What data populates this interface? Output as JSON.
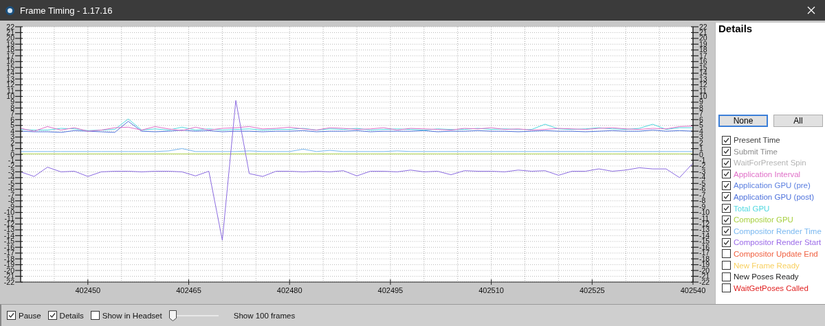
{
  "window": {
    "title": "Frame Timing - 1.17.16"
  },
  "chart": {
    "chart_data": {
      "type": "line",
      "x": [
        402440,
        402442,
        402444,
        402446,
        402448,
        402450,
        402452,
        402454,
        402456,
        402458,
        402460,
        402462,
        402464,
        402466,
        402468,
        402470,
        402472,
        402474,
        402476,
        402478,
        402480,
        402482,
        402484,
        402486,
        402488,
        402490,
        402492,
        402494,
        402496,
        402498,
        402500,
        402502,
        402504,
        402506,
        402508,
        402510,
        402512,
        402514,
        402516,
        402518,
        402520,
        402522,
        402524,
        402526,
        402528,
        402530,
        402532,
        402534,
        402536,
        402538,
        402540
      ],
      "series": [
        {
          "color": "#4f73dc",
          "values": [
            4,
            3.9,
            3.9,
            3.8,
            4.1,
            4.0,
            3.9,
            3.8,
            5.7,
            4.0,
            3.9,
            4.0,
            4.2,
            4.0,
            4.1,
            3.9,
            4.0,
            4.0,
            3.9,
            4.0,
            4.0,
            4.1,
            3.9,
            4.0,
            4.0,
            4.1,
            3.9,
            4.0,
            4.0,
            4.0,
            4.1,
            3.9,
            4.0,
            4.0,
            4.1,
            4.0,
            4.0,
            3.9,
            4.0,
            4.1,
            4.0,
            4.0,
            3.9,
            4.0,
            4.1,
            4.0,
            4.0,
            4.2,
            4.0,
            4.1,
            4.0
          ]
        },
        {
          "color": "#50d8e0",
          "values": [
            4.3,
            4.2,
            4.2,
            4.5,
            4.4,
            4.1,
            4.2,
            4.3,
            6.1,
            4.2,
            4.4,
            4.2,
            4.7,
            4.2,
            4.4,
            4.2,
            4.3,
            4.4,
            4.2,
            4.3,
            4.3,
            4.5,
            4.2,
            4.4,
            4.3,
            4.5,
            4.2,
            4.3,
            4.4,
            4.3,
            4.2,
            4.4,
            4.3,
            4.3,
            4.5,
            4.3,
            4.4,
            4.3,
            4.3,
            5.2,
            4.4,
            4.3,
            4.4,
            4.6,
            4.4,
            4.3,
            4.5,
            5.2,
            4.3,
            4.6,
            4.6
          ]
        },
        {
          "color": "#e070c8",
          "values": [
            4.5,
            4.0,
            4.8,
            4.2,
            4.6,
            4.0,
            4.2,
            4.6,
            4.7,
            4.2,
            4.8,
            4.4,
            4.1,
            4.7,
            4.2,
            4.5,
            4.6,
            4.8,
            4.4,
            4.5,
            4.7,
            4.4,
            4.2,
            4.6,
            4.5,
            4.3,
            4.4,
            4.6,
            4.2,
            4.5,
            4.4,
            4.3,
            4.2,
            4.5,
            4.4,
            4.6,
            4.3,
            4.4,
            4.2,
            4.3,
            4.5,
            4.4,
            4.3,
            4.5,
            4.6,
            4.4,
            4.3,
            4.5,
            4.4,
            4.8,
            4.9
          ]
        },
        {
          "color": "#7ab8f0",
          "values": [
            0.5,
            0.5,
            0.5,
            0.5,
            0.5,
            0.5,
            0.5,
            0.5,
            0.5,
            0.5,
            0.5,
            0.6,
            1.0,
            0.5,
            0.5,
            0.5,
            0.5,
            0.6,
            0.5,
            0.5,
            0.5,
            0.9,
            0.5,
            0.7,
            0.5,
            0.5,
            0.5,
            0.5,
            0.6,
            0.5,
            0.5,
            0.5,
            0.5,
            0.5,
            0.5,
            0.5,
            0.5,
            0.5,
            0.5,
            0.5,
            0.5,
            0.5,
            0.5,
            0.5,
            0.5,
            0.5,
            0.5,
            0.5,
            0.5,
            0.5,
            0.5
          ]
        },
        {
          "color": "#a8d040",
          "values": [
            0.1,
            0.1,
            0.1,
            0.1,
            0.1,
            0.1,
            0.1,
            0.1,
            0.1,
            0.1,
            0.1,
            0.1,
            0.1,
            0.1,
            0.1,
            0.1,
            0.1,
            0.1,
            0.1,
            0.1,
            0.1,
            0.1,
            0.1,
            0.1,
            0.1,
            0.1,
            0.1,
            0.1,
            0.1,
            0.1,
            0.1,
            0.1,
            0.1,
            0.1,
            0.1,
            0.1,
            0.1,
            0.1,
            0.1,
            0.1,
            0.1,
            0.1,
            0.1,
            0.1,
            0.1,
            0.1,
            0.1,
            0.1,
            0.1,
            0.1,
            0.1
          ]
        },
        {
          "color": "#8a6ae0",
          "values": [
            -3,
            -3.8,
            -2.2,
            -3,
            -2.9,
            -3.8,
            -3,
            -2.9,
            -2.9,
            -3,
            -2.9,
            -2.9,
            -3,
            -3.7,
            -2.9,
            -14.8,
            9.3,
            -3.3,
            -3.8,
            -2.9,
            -2.9,
            -3,
            -2.9,
            -3,
            -2.8,
            -3.7,
            -2.9,
            -2.9,
            -3,
            -2.7,
            -3,
            -2.9,
            -3.5,
            -2.8,
            -2.9,
            -2.9,
            -3,
            -2.7,
            -2.9,
            -2.8,
            -3.6,
            -2.9,
            -2.9,
            -2.5,
            -2.9,
            -2.7,
            -2.3,
            -2.5,
            -2.5,
            -4.0,
            -1.5
          ]
        }
      ],
      "xlim": [
        402440,
        402540
      ],
      "ylim": [
        -22,
        22
      ],
      "xticks": [
        402450,
        402465,
        402480,
        402495,
        402510,
        402525,
        402540
      ],
      "yticks": [
        22,
        21,
        20,
        19,
        18,
        17,
        16,
        15,
        14,
        13,
        12,
        11,
        10,
        9,
        8,
        7,
        6,
        5,
        4,
        3,
        2,
        1,
        0,
        -1,
        -2,
        -3,
        -4,
        -5,
        -6,
        -7,
        -8,
        -9,
        -10,
        -11,
        -12,
        -13,
        -14,
        -15,
        -16,
        -17,
        -18,
        -19,
        -20,
        -21,
        -22
      ],
      "grid": true
    },
    "right_axis_labels": [
      "22",
      "21",
      "20",
      "19",
      "18",
      "17",
      "16",
      "15",
      "14",
      "13",
      "12",
      "11",
      "10",
      "9",
      "8",
      "7",
      "6",
      "5",
      "4",
      "3",
      "2",
      "1",
      "0",
      "-1",
      "-2",
      "-3",
      "-4",
      "-5",
      "-6",
      "-7",
      "-8",
      "-9",
      "-10",
      "-11",
      "-12",
      "-13",
      "-14",
      "-15",
      "-16",
      "-17",
      "-18",
      "-19",
      "-20",
      "-21",
      "-22"
    ]
  },
  "details": {
    "title": "Details",
    "buttons": [
      {
        "label": "None",
        "selected": true
      },
      {
        "label": "All",
        "selected": false
      }
    ],
    "items": [
      {
        "label": "Present Time",
        "checked": true,
        "color": "#404040"
      },
      {
        "label": "Submit Time",
        "checked": true,
        "color": "#8c8c8c"
      },
      {
        "label": "WaitForPresent Spin",
        "checked": true,
        "color": "#b4b4b4"
      },
      {
        "label": "Application Interval",
        "checked": true,
        "color": "#e070c8"
      },
      {
        "label": "Application GPU (pre)",
        "checked": true,
        "color": "#5b7fe0"
      },
      {
        "label": "Application GPU (post)",
        "checked": true,
        "color": "#4f73dc"
      },
      {
        "label": "Total GPU",
        "checked": true,
        "color": "#50d8e0"
      },
      {
        "label": "Compositor GPU",
        "checked": true,
        "color": "#a8d040"
      },
      {
        "label": "Compositor Render Time",
        "checked": true,
        "color": "#7ab8f0"
      },
      {
        "label": "Compositor Render Start",
        "checked": true,
        "color": "#9b6ae8"
      },
      {
        "label": "Compositor Update End",
        "checked": false,
        "color": "#f06040"
      },
      {
        "label": "New Frame Ready",
        "checked": false,
        "color": "#f8d060"
      },
      {
        "label": "New Poses Ready",
        "checked": false,
        "color": "#202020"
      },
      {
        "label": "WaitGetPoses Called",
        "checked": false,
        "color": "#e02020"
      }
    ]
  },
  "toolbar": {
    "items": [
      {
        "kind": "checkbox",
        "label": "Pause",
        "checked": true
      },
      {
        "kind": "checkbox",
        "label": "Details",
        "checked": true
      },
      {
        "kind": "checkbox",
        "label": "Show in Headset",
        "checked": false
      },
      {
        "kind": "slider",
        "level": 0,
        "reading": "Show 100 frames"
      }
    ]
  }
}
